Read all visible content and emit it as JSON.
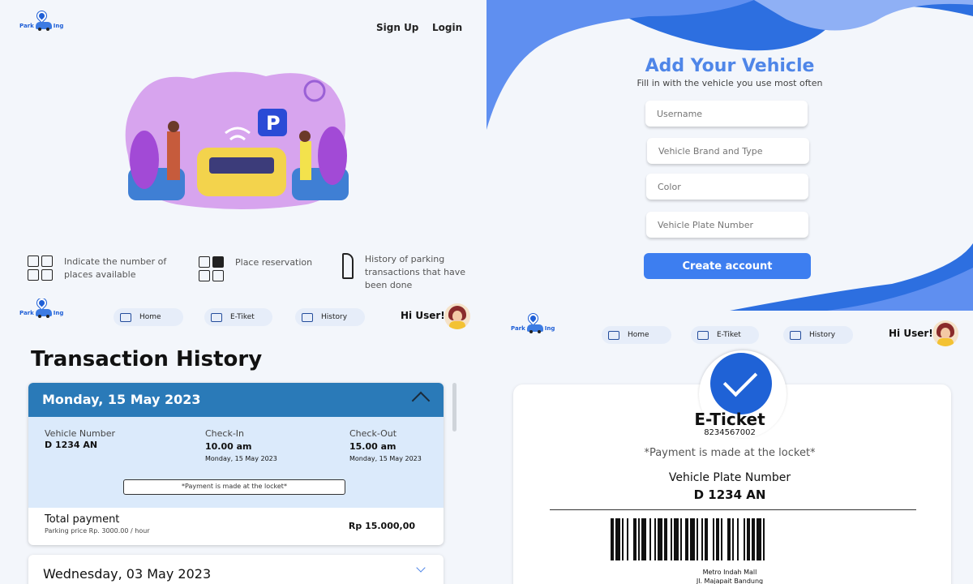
{
  "brand": {
    "left": "Park",
    "right": "Ing"
  },
  "landing": {
    "signup": "Sign Up",
    "login": "Login",
    "features": [
      {
        "icon": "grid-icon",
        "text": "Indicate the number of places available"
      },
      {
        "icon": "reservation-grid-icon",
        "text": "Place reservation"
      },
      {
        "icon": "document-icon",
        "text": "History of parking transactions that have been done"
      }
    ]
  },
  "add_vehicle": {
    "title": "Add Your Vehicle",
    "subtitle": "Fill in with the vehicle you use most often",
    "fields": [
      "Username",
      "Vehicle Brand and Type",
      "Color",
      "Vehicle Plate Number"
    ],
    "submit": "Create account"
  },
  "nav": {
    "home": "Home",
    "eticket": "E-Tiket",
    "history": "History",
    "greeting": "Hi User!"
  },
  "history": {
    "title": "Transaction History",
    "entry": {
      "date": "Monday, 15 May 2023",
      "vehicle_label": "Vehicle Number",
      "vehicle_value": "D 1234 AN",
      "checkin_label": "Check-In",
      "checkin_time": "10.00 am",
      "checkin_date": "Monday, 15 May 2023",
      "checkout_label": "Check-Out",
      "checkout_time": "15.00 am",
      "checkout_date": "Monday, 15 May 2023",
      "note": "*Payment is made at the locket*",
      "total_label": "Total payment",
      "price_note": "Parking price Rp. 3000.00 / hour",
      "amount": "Rp 15.000,00"
    },
    "entry2_date": "Wednesday, 03 May 2023"
  },
  "eticket": {
    "title": "E-Ticket",
    "number": "8234567002",
    "note": "*Payment is made at the locket*",
    "plate_label": "Vehicle Plate Number",
    "plate": "D 1234 AN",
    "location1": "Metro Indah Mall",
    "location2": "Jl. Majapait Bandung"
  },
  "colors": {
    "accent": "#3d7ef0",
    "header_blue": "#2a7ab8",
    "body_blue": "#dbeafb",
    "wave": "#2d6fe0"
  }
}
